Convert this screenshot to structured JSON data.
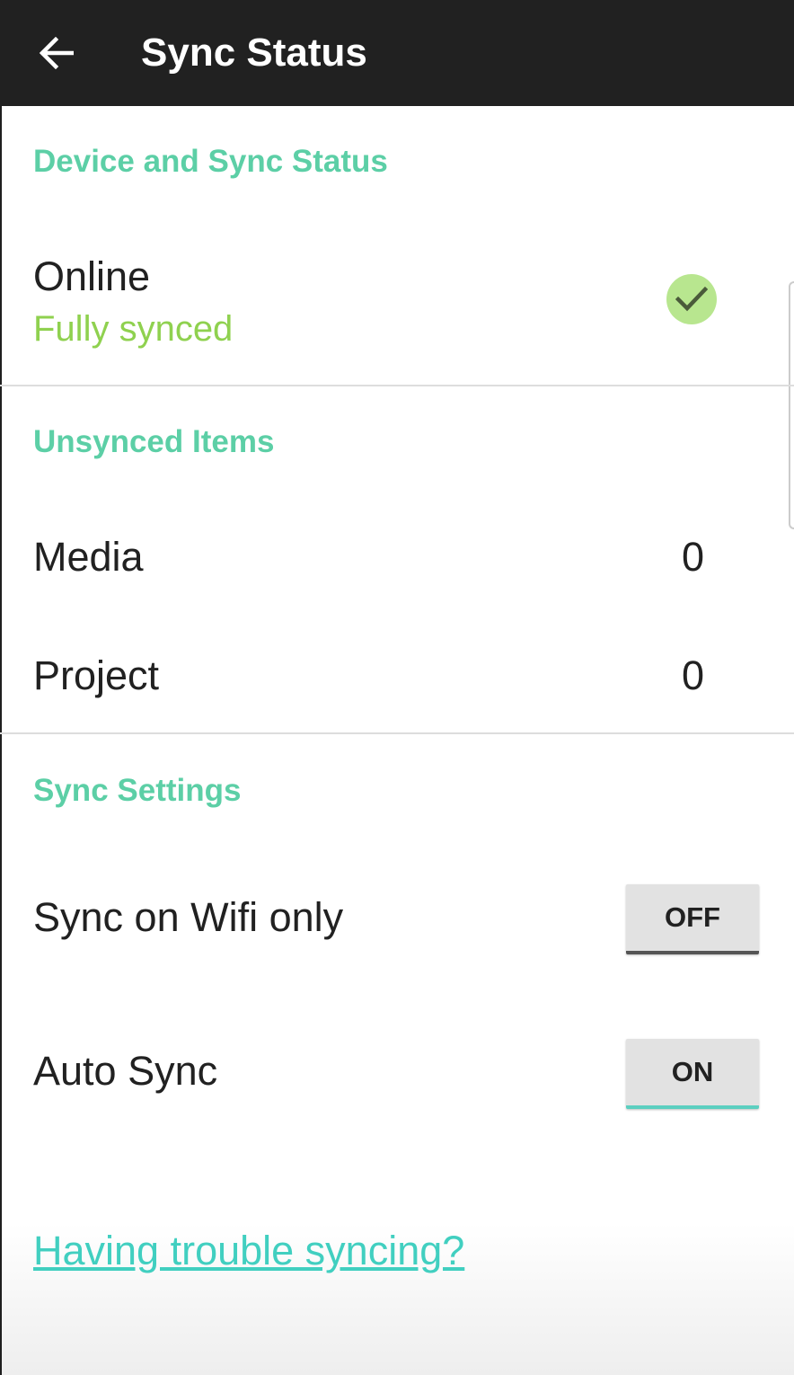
{
  "header": {
    "title": "Sync Status",
    "back_icon": "arrow-left-icon"
  },
  "device_section": {
    "title": "Device and Sync Status",
    "status_label": "Online",
    "status_detail": "Fully synced",
    "status_icon": "check-circle-icon"
  },
  "unsynced_section": {
    "title": "Unsynced Items",
    "rows": [
      {
        "label": "Media",
        "value": "0"
      },
      {
        "label": "Project",
        "value": "0"
      }
    ]
  },
  "settings_section": {
    "title": "Sync Settings",
    "wifi_only": {
      "label": "Sync on Wifi only",
      "state": "OFF"
    },
    "auto_sync": {
      "label": "Auto Sync",
      "state": "ON"
    }
  },
  "help_link": "Having trouble syncing?",
  "colors": {
    "app_bar": "#212121",
    "section_header": "#5ccfa6",
    "synced_text": "#8fd14f",
    "link": "#41cfc0",
    "toggle_on_indicator": "#5ccfc0"
  }
}
